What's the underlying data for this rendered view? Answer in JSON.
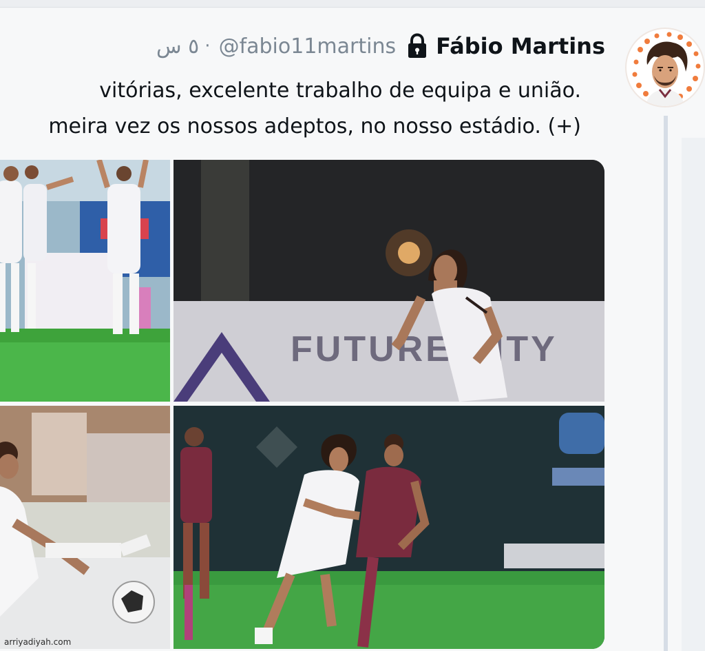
{
  "tweet": {
    "display_name": "Fábio Martins",
    "handle": "@fabio11martins",
    "separator": "·",
    "time": "٥ س",
    "text_lines": [
      "vitórias, excelente trabalho de equipa e união.",
      "meira vez os nossos adeptos, no nosso estádio. (+)"
    ]
  },
  "media": {
    "billboard_text": "FUTURE CITY"
  },
  "watermark": "arriyadiyah.com",
  "colors": {
    "background": "#f7f8f9",
    "thread_line": "#d6dde6",
    "muted_text": "#7b8793",
    "primary_text": "#0f1419",
    "pitch_green": "#2f9e31"
  },
  "icons": {
    "lock": "lock-icon",
    "avatar": "avatar-illustration"
  }
}
